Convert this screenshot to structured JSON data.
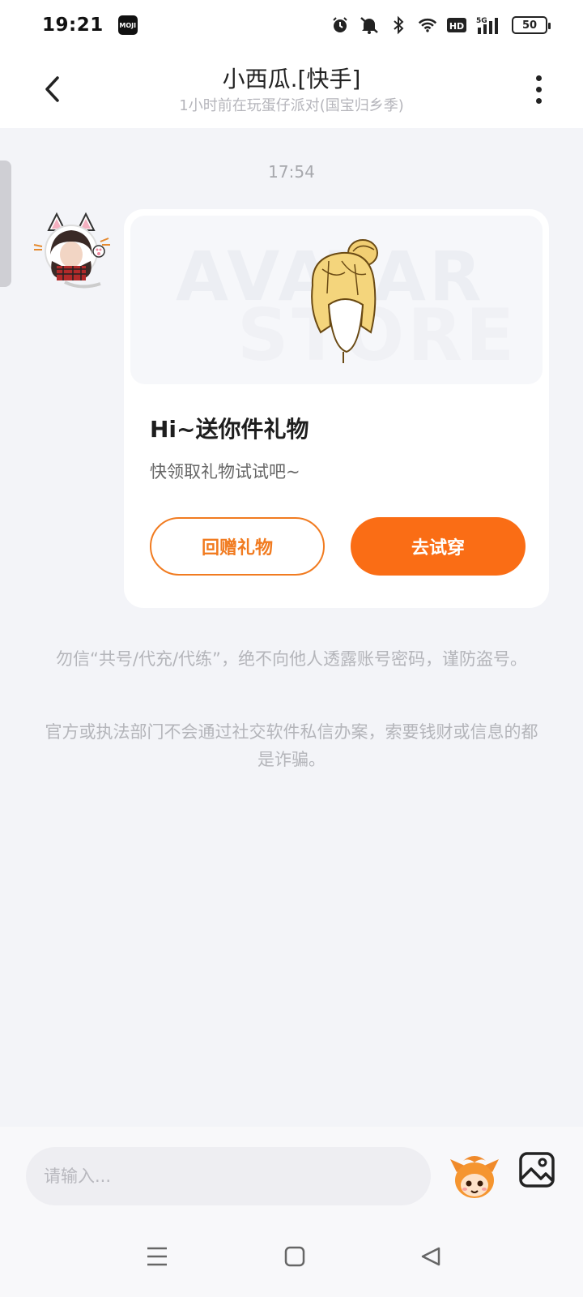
{
  "status_bar": {
    "time": "19:21",
    "app_badge": "MOJI",
    "hd_label": "HD",
    "network_label": "5G",
    "battery_level": "50",
    "icons": [
      "alarm-icon",
      "mute-icon",
      "bluetooth-icon",
      "wifi-icon",
      "hd-icon",
      "signal-icon",
      "battery-icon"
    ]
  },
  "header": {
    "title": "小西瓜.[快手]",
    "subtitle": "1小时前在玩蛋仔派对(国宝归乡季)"
  },
  "chat": {
    "timestamp": "17:54",
    "gift_card": {
      "watermark_line1": "AVATAR",
      "watermark_line2": "STORE",
      "title": "Hi~送你件礼物",
      "description": "快领取礼物试试吧~",
      "return_gift_label": "回赠礼物",
      "try_on_label": "去试穿"
    },
    "notices": [
      "勿信“共号/代充/代练”，绝不向他人透露账号密码，谨防盗号。",
      "官方或执法部门不会通过社交软件私信办案，索要钱财或信息的都是诈骗。"
    ]
  },
  "input": {
    "placeholder": "请输入..."
  },
  "colors": {
    "accent": "#fa6d15",
    "accent_outline": "#f17b20",
    "background": "#f3f4f8"
  }
}
